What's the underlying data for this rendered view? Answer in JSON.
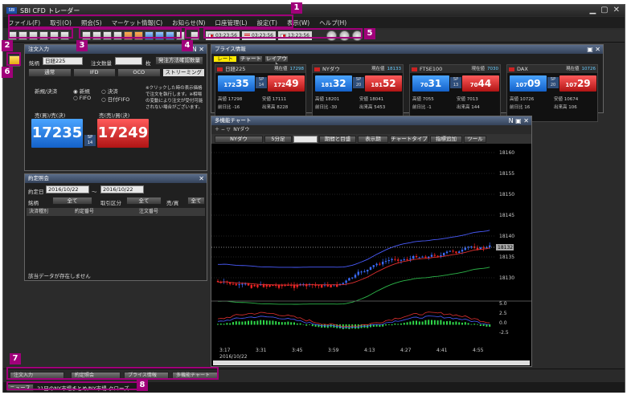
{
  "app": {
    "title": "SBI CFD トレーダー",
    "logo": "SBI"
  },
  "menu": [
    "ファイル(F)",
    "取引(O)",
    "照会(S)",
    "マーケット情報(C)",
    "お知らせ(N)",
    "口座管理(L)",
    "設定(T)",
    "表示(W)",
    "ヘルプ(H)"
  ],
  "clocks": [
    "03:23:56",
    "03:23:56",
    "13:23:56"
  ],
  "callouts": [
    "1",
    "2",
    "3",
    "4",
    "5",
    "6",
    "7",
    "8"
  ],
  "order": {
    "title": "注文入力",
    "symbol": "日経225",
    "qty_label": "注文数量",
    "qty_unit": "枚",
    "qty_button": "発注方法確認数量",
    "tabs": [
      "通常",
      "IFD",
      "OCO",
      "ストリーミング"
    ],
    "newclose_label": "新規/決済",
    "radio_new": "新規",
    "radio_close": "決済",
    "radio_fifo": "FIFO",
    "radio_date": "日付FIFO",
    "note": "※クリックした時の表示価格で注文を執行します。※相場の変動により注文が受付可能されない場合がございます。",
    "buy_label": "売(買)/売(決)",
    "sell_label": "売(売)/買(決)",
    "bid": "17235",
    "ask": "17249",
    "sp_label": "SP",
    "sp": "14"
  },
  "history": {
    "title": "約定照会",
    "date_label": "約定日",
    "date_from": "2016/10/22",
    "date_sep": "〜",
    "date_to": "2016/10/22",
    "symbol_label": "銘柄",
    "all": "全て",
    "kind_label": "取引区分",
    "side_label": "売/買",
    "cols": [
      "決済種別",
      "約定番号",
      "注文番号"
    ],
    "empty": "該当データが存在しません"
  },
  "rates": {
    "title": "プライス情報",
    "tabs": [
      "レート",
      "チャート",
      "レイアウト"
    ],
    "items": [
      {
        "name": "日経225",
        "now_label": "現在値",
        "now": "17298",
        "bid_s": "172",
        "bid_b": "35",
        "sp": "14",
        "ask_s": "172",
        "ask_b": "49",
        "hi_label": "高値",
        "hi": "17298",
        "lo_label": "安値",
        "lo": "17111",
        "chg_label": "前日比",
        "chg": "-16",
        "vol_label": "出来高",
        "vol": "8228",
        "flag": "jp"
      },
      {
        "name": "NYダウ",
        "now_label": "現在値",
        "now": "18133",
        "bid_s": "181",
        "bid_b": "32",
        "sp": "20",
        "ask_s": "181",
        "ask_b": "52",
        "hi_label": "高値",
        "hi": "18201",
        "lo_label": "安値",
        "lo": "18041",
        "chg_label": "前日比",
        "chg": "-30",
        "vol_label": "出来高",
        "vol": "5453",
        "flag": "us"
      },
      {
        "name": "FTSE100",
        "now_label": "現在値",
        "now": "7030",
        "bid_s": "70",
        "bid_b": "31",
        "sp": "13",
        "ask_s": "70",
        "ask_b": "44",
        "hi_label": "高値",
        "hi": "7055",
        "lo_label": "安値",
        "lo": "7013",
        "chg_label": "前日比",
        "chg": "-1",
        "vol_label": "出来高",
        "vol": "144",
        "flag": "uk"
      },
      {
        "name": "DAX",
        "now_label": "現在値",
        "now": "10726",
        "bid_s": "107",
        "bid_b": "09",
        "sp": "20",
        "ask_s": "107",
        "ask_b": "29",
        "hi_label": "高値",
        "hi": "10726",
        "lo_label": "安値",
        "lo": "10674",
        "chg_label": "前日比",
        "chg": "16",
        "vol_label": "出来高",
        "vol": "106",
        "flag": "de"
      }
    ]
  },
  "chart": {
    "title": "多機能チャート",
    "symbol": "NYダウ",
    "period": "5分足",
    "buttons": [
      "期間と目盛",
      "表示期",
      "チャートタイプ",
      "指標追加",
      "ツール"
    ],
    "yticks": [
      "18160",
      "18155",
      "18150",
      "18145",
      "18140",
      "18135",
      "18130"
    ],
    "last": "18132",
    "xticks": [
      "3:17",
      "3:31",
      "3:45",
      "3:59",
      "4:13",
      "4:27",
      "4:41",
      "4:55"
    ],
    "xdate": "2016/10/22",
    "sub_ticks": [
      "5.0",
      "2.5",
      "0.0",
      "-2.5"
    ]
  },
  "taskbar": [
    "注文入力",
    "約定照会",
    "プライス情報",
    "多機能チャート"
  ],
  "news": {
    "label": "ニュース",
    "text": "21日のNY市場まとめ/NY市場-クローズ"
  },
  "colors": {
    "accent": "#a0007a",
    "bid": "#1461c9",
    "ask": "#b01414"
  }
}
